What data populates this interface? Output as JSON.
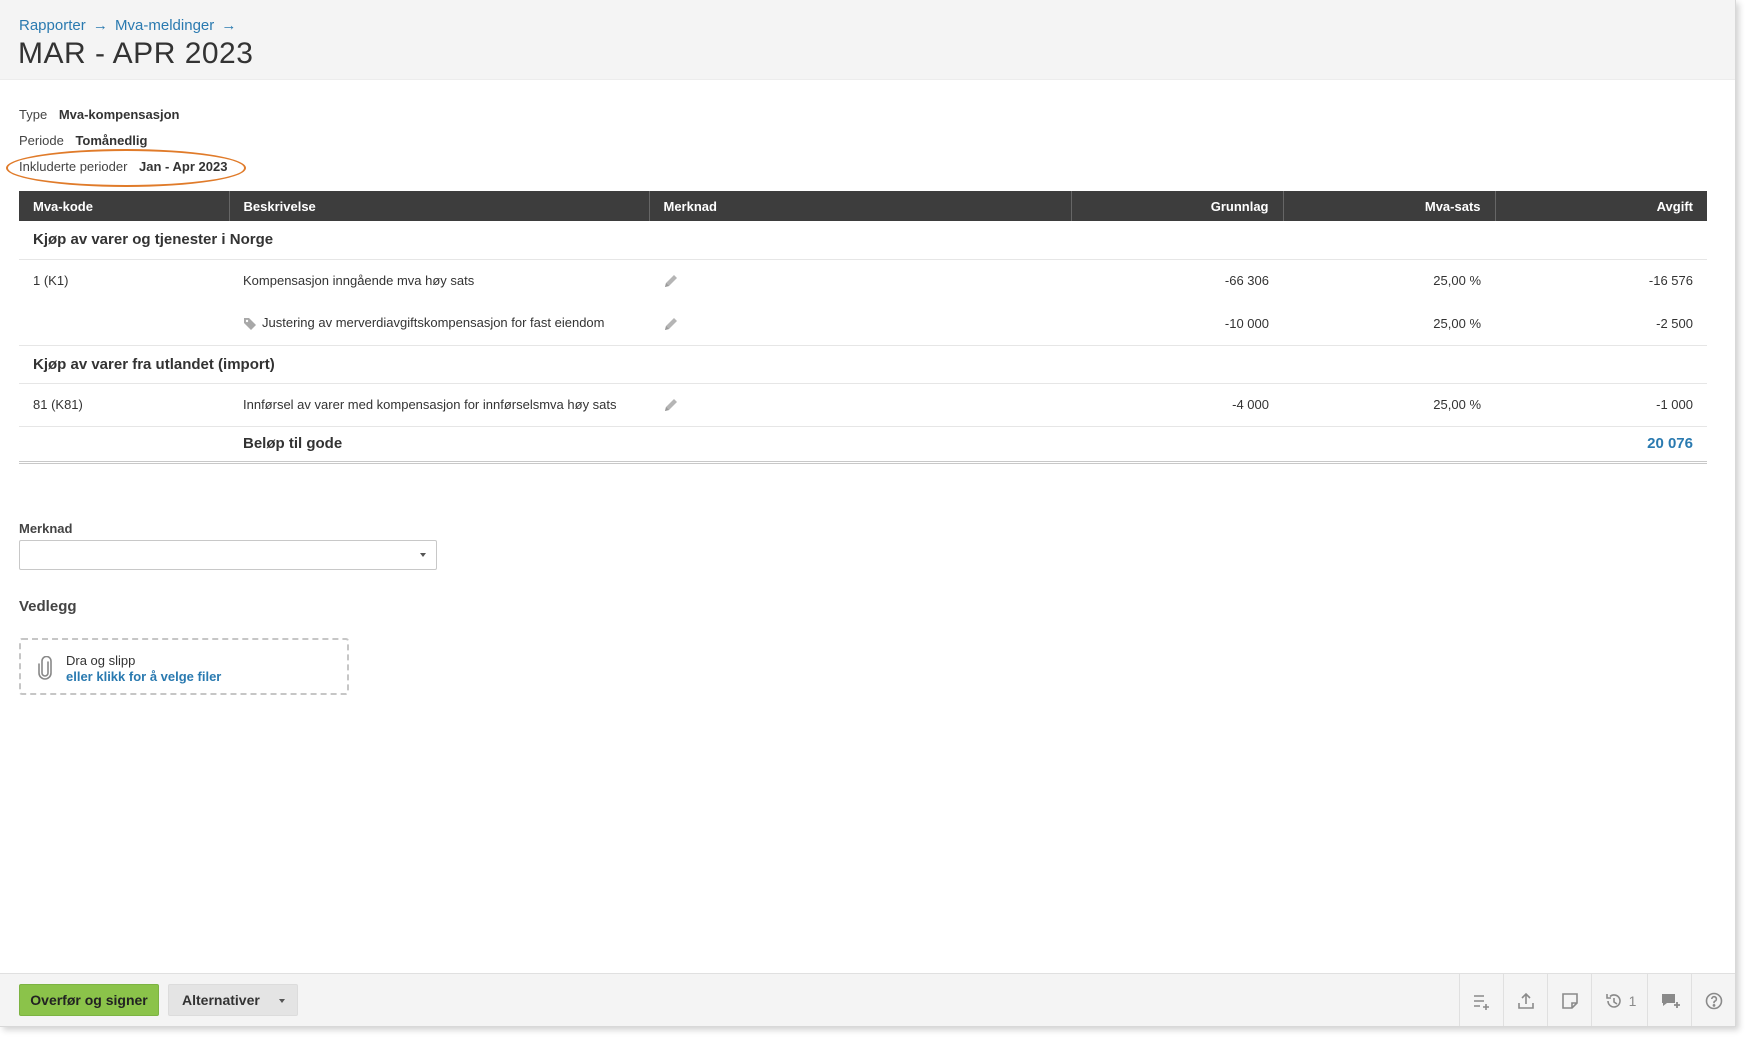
{
  "breadcrumb": {
    "items": [
      "Rapporter",
      "Mva-meldinger"
    ],
    "separator": "→"
  },
  "page": {
    "title": "MAR - APR 2023"
  },
  "meta": {
    "type_label": "Type",
    "type_value": "Mva-kompensasjon",
    "period_label": "Periode",
    "period_value": "Tomånedlig",
    "included_label": "Inkluderte perioder",
    "included_value": "Jan - Apr 2023"
  },
  "table": {
    "headers": {
      "code": "Mva-kode",
      "description": "Beskrivelse",
      "note": "Merknad",
      "base": "Grunnlag",
      "rate": "Mva-sats",
      "fee": "Avgift"
    },
    "groups": [
      {
        "title": "Kjøp av varer og tjenester i Norge",
        "lines": [
          {
            "code": "1 (K1)",
            "description": "Kompensasjon inngående mva høy sats",
            "base": "-66 306",
            "rate": "25,00 %",
            "fee": "-16 576"
          },
          {
            "code": "",
            "description": "Justering av merverdiavgiftskompensasjon for fast eiendom",
            "base": "-10 000",
            "rate": "25,00 %",
            "fee": "-2 500"
          }
        ]
      },
      {
        "title": "Kjøp av varer fra utlandet (import)",
        "lines": [
          {
            "code": "81 (K81)",
            "description": "Innførsel av varer med kompensasjon for innførselsmva høy sats",
            "base": "-4 000",
            "rate": "25,00 %",
            "fee": "-1 000"
          }
        ]
      }
    ],
    "total_label": "Beløp til gode",
    "total_value": "20 076"
  },
  "merknad": {
    "label": "Merknad",
    "value": ""
  },
  "vedlegg": {
    "label": "Vedlegg",
    "drop_text": "Dra og slipp",
    "click_text": "eller klikk for å velge filer"
  },
  "footer": {
    "primary_button": "Overfør og signer",
    "alt_button": "Alternativer",
    "toolbar": {
      "icons": [
        "list-add-icon",
        "export-icon",
        "note-icon",
        "history-icon",
        "comment-add-icon",
        "help-icon"
      ],
      "history_count": "1"
    }
  },
  "colors": {
    "link": "#2a7ab0",
    "primary": "#8bc34a",
    "header_bg": "#3d3d3d",
    "highlight": "#e07b2a"
  }
}
